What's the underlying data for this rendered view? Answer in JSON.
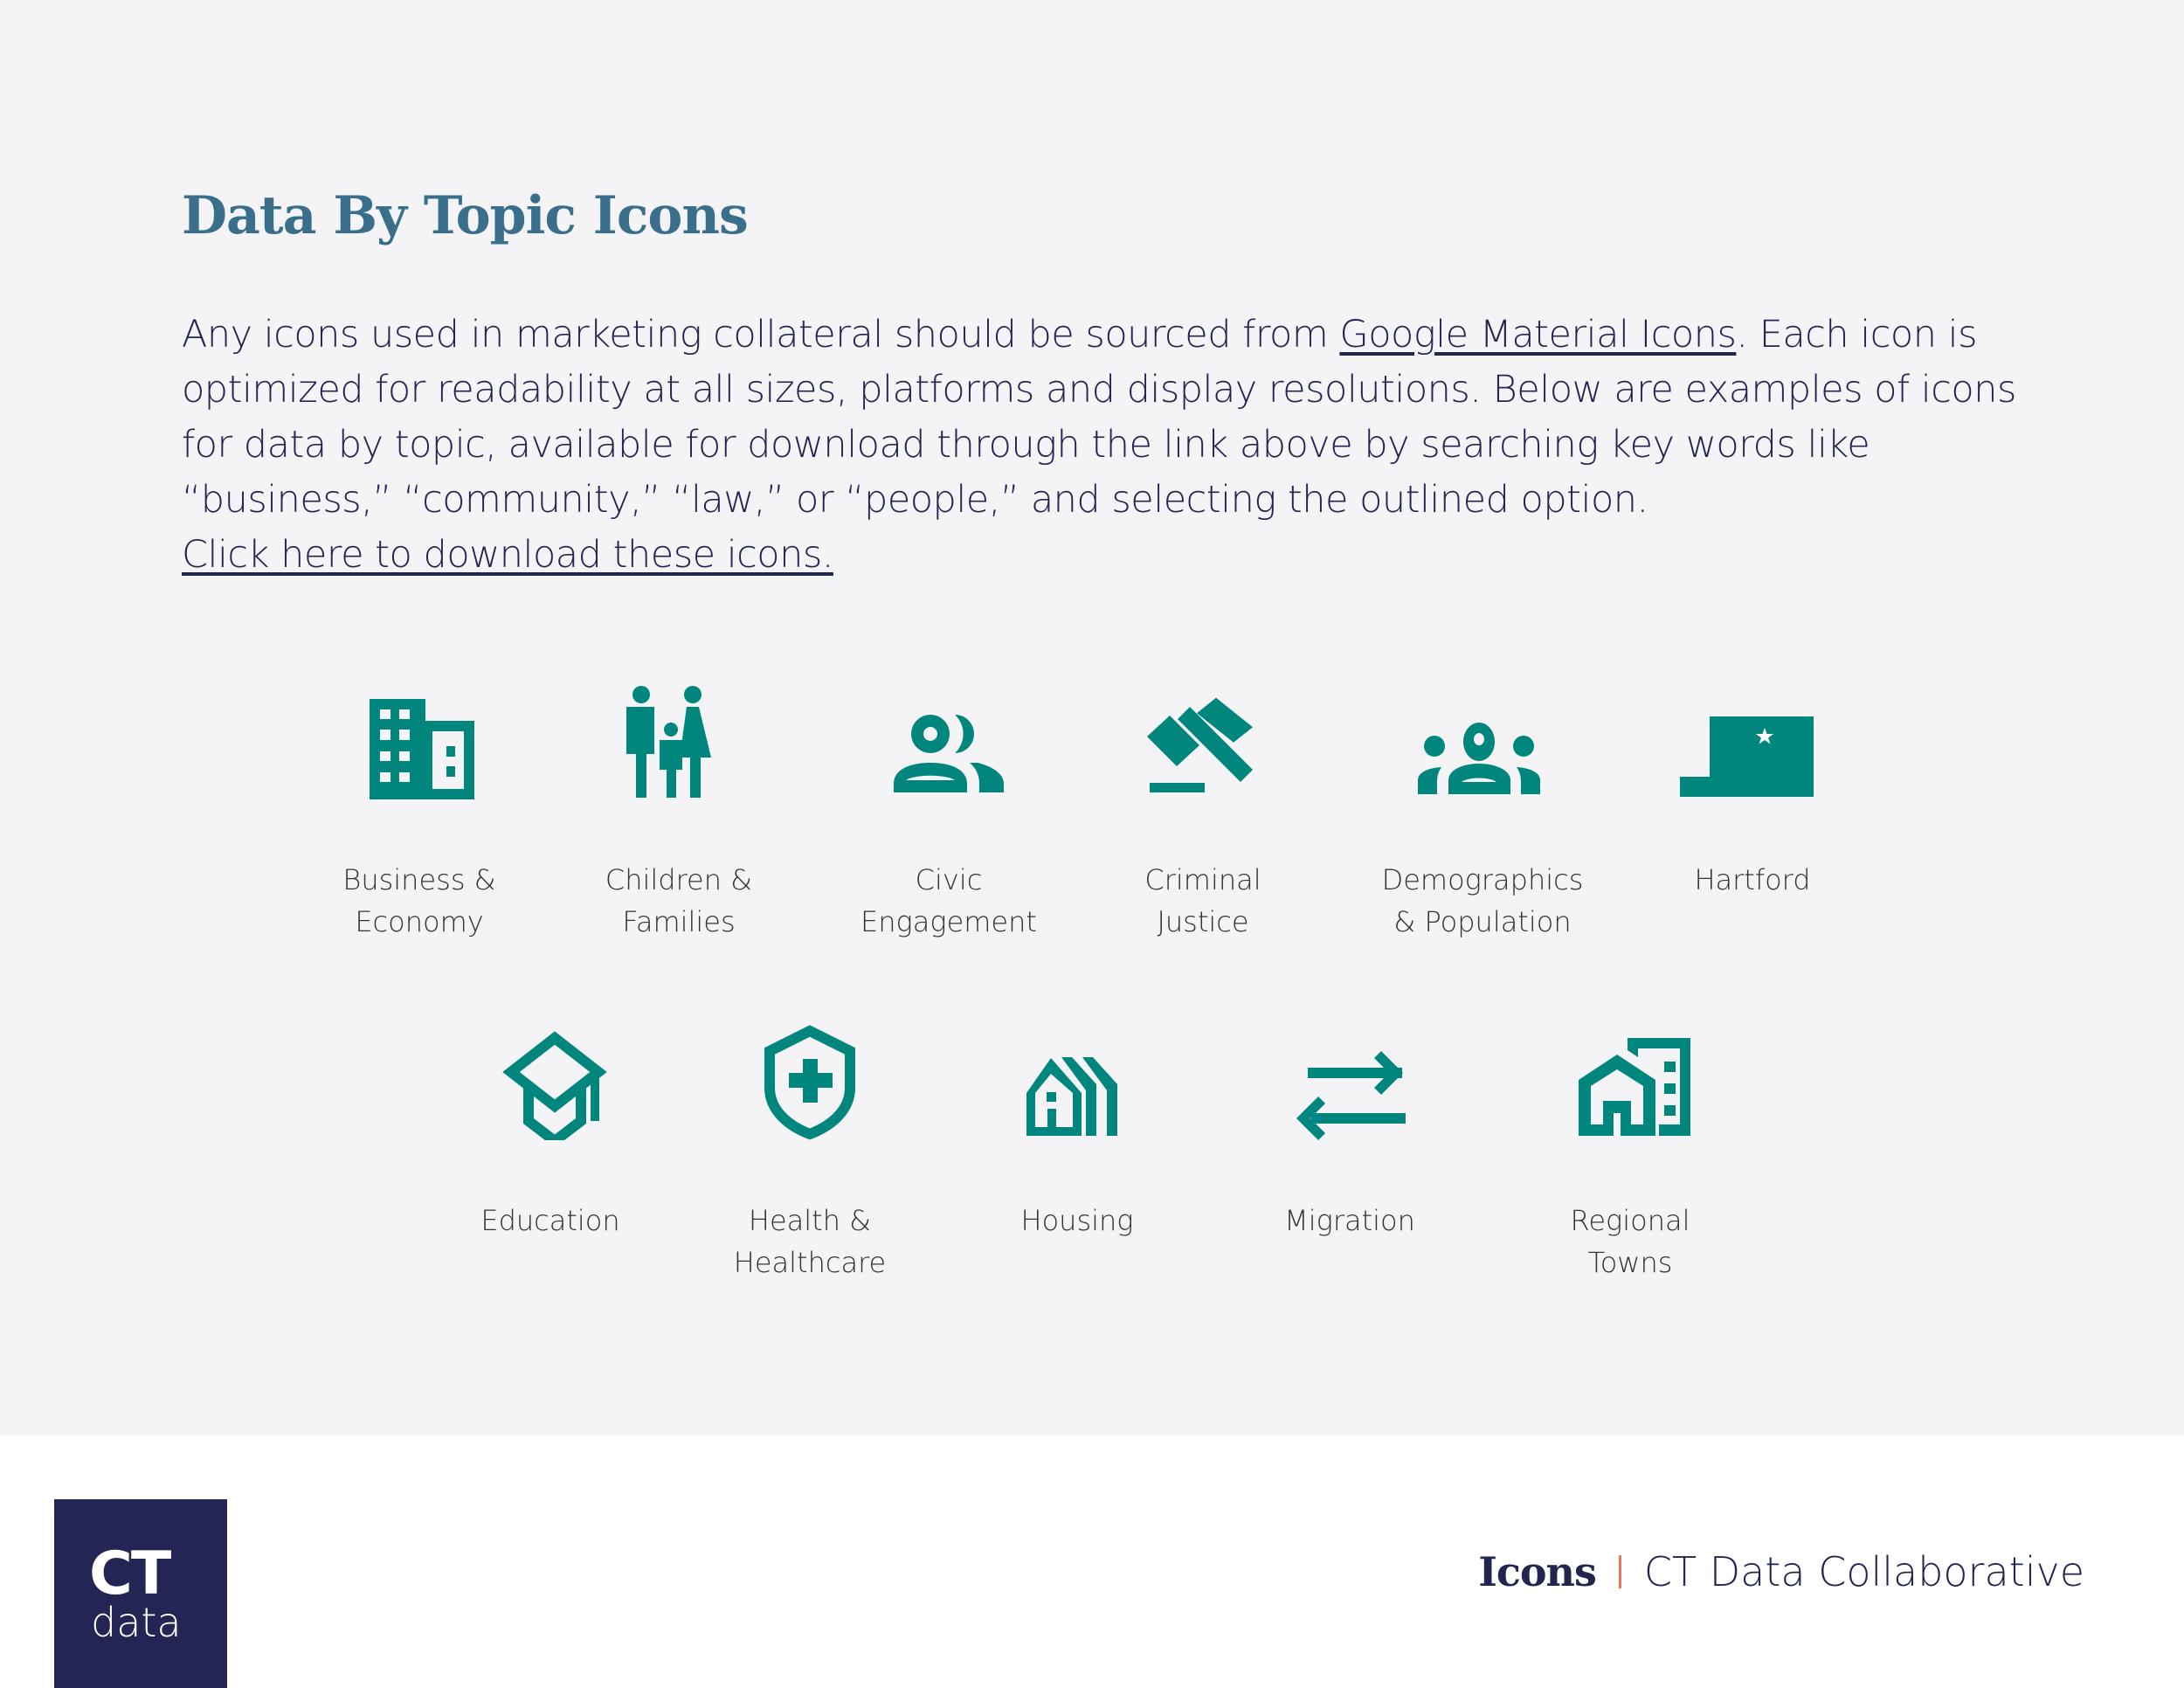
{
  "page": {
    "title": "Data By Topic Icons",
    "intro": {
      "before_link": "Any icons used in marketing collateral should be sourced from ",
      "link_text": "Google Material Icons",
      "after_link": ". Each icon is optimized for readability at all sizes, platforms and display resolutions. Below are examples of icons for data by topic, available for download through the link above by searching key words like “business,” “community,” “law,” or “people,” and selecting the outlined option.",
      "download_link": "Click here to download these icons."
    },
    "accent_color": "#00867c",
    "icons": [
      {
        "name": "business-icon",
        "label": "Business &\nEconomy"
      },
      {
        "name": "family-icon",
        "label": "Children &\nFamilies"
      },
      {
        "name": "people-icon",
        "label": "Civic\nEngagement"
      },
      {
        "name": "gavel-icon",
        "label": "Criminal\nJustice"
      },
      {
        "name": "groups-icon",
        "label": "Demographics\n& Population"
      },
      {
        "name": "connecticut-map-icon",
        "label": "Hartford"
      },
      {
        "name": "school-icon",
        "label": "Education"
      },
      {
        "name": "health-shield-icon",
        "label": "Health &\nHealthcare"
      },
      {
        "name": "houses-icon",
        "label": "Housing"
      },
      {
        "name": "swap-arrows-icon",
        "label": "Migration"
      },
      {
        "name": "home-work-icon",
        "label": "Regional\nTowns"
      }
    ]
  },
  "footer": {
    "logo_top": "CT",
    "logo_bottom": "data",
    "section": "Icons",
    "org": "CT Data Collaborative"
  }
}
